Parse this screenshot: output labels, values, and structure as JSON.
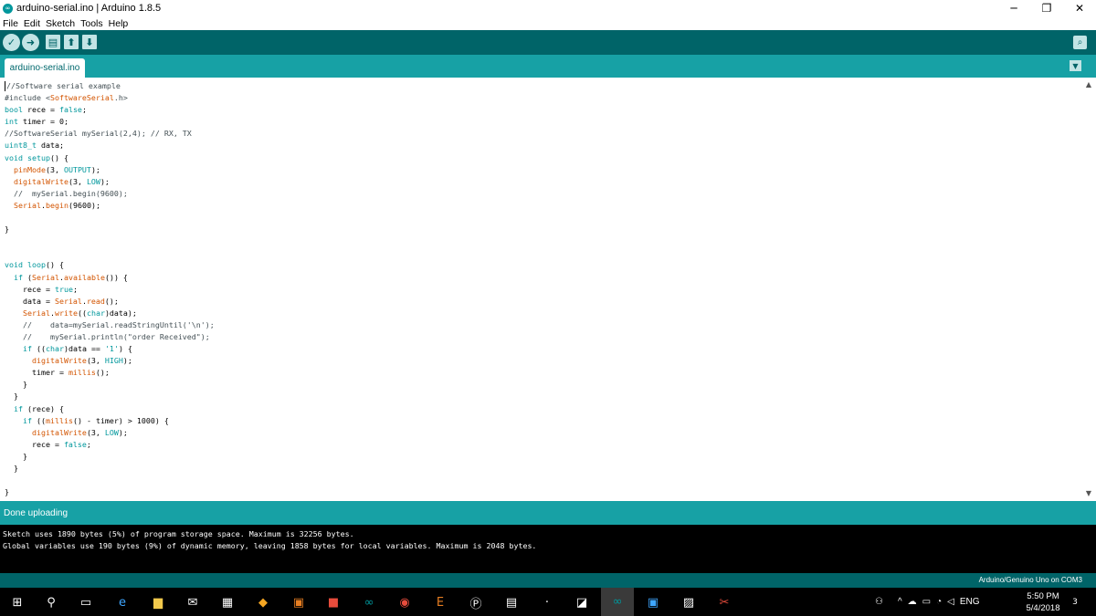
{
  "window": {
    "title": "arduino-serial.ino | Arduino 1.8.5",
    "logo_icon": "arduino-infinity-icon",
    "controls": [
      "─",
      "❐",
      "✕"
    ]
  },
  "menu": [
    "File",
    "Edit",
    "Sketch",
    "Tools",
    "Help"
  ],
  "toolbar": {
    "buttons": [
      "verify-icon",
      "upload-icon",
      "new-icon",
      "open-icon",
      "save-icon"
    ],
    "serial_monitor_icon": "magnifier-icon",
    "background": "#006468",
    "button_color": "#c2e4e5"
  },
  "tabs": {
    "active": "arduino-serial.ino",
    "menu_icon": "dropdown-triangle-icon"
  },
  "editor": {
    "lines": [
      [
        {
          "t": "//Software serial example",
          "c": "cm"
        }
      ],
      [
        {
          "t": "#include <",
          "c": "cm"
        },
        {
          "t": "SoftwareSerial",
          "c": "fn"
        },
        {
          "t": ".h>",
          "c": "cm"
        }
      ],
      [
        {
          "t": "bool",
          "c": "kw"
        },
        {
          "t": " rece = "
        },
        {
          "t": "false",
          "c": "kw"
        },
        {
          "t": ";"
        }
      ],
      [
        {
          "t": "int",
          "c": "kw"
        },
        {
          "t": " timer = 0;"
        }
      ],
      [
        {
          "t": "//SoftwareSerial mySerial(2,4); // RX, TX",
          "c": "cm"
        }
      ],
      [
        {
          "t": "uint8_t",
          "c": "kw"
        },
        {
          "t": " data;"
        }
      ],
      [
        {
          "t": "void",
          "c": "kw"
        },
        {
          "t": " "
        },
        {
          "t": "setup",
          "c": "kw"
        },
        {
          "t": "() {"
        }
      ],
      [
        {
          "t": "  "
        },
        {
          "t": "pinMode",
          "c": "fn"
        },
        {
          "t": "(3, "
        },
        {
          "t": "OUTPUT",
          "c": "kw"
        },
        {
          "t": ");"
        }
      ],
      [
        {
          "t": "  "
        },
        {
          "t": "digitalWrite",
          "c": "fn"
        },
        {
          "t": "(3, "
        },
        {
          "t": "LOW",
          "c": "kw"
        },
        {
          "t": ");"
        }
      ],
      [
        {
          "t": "  //  mySerial.begin(9600);",
          "c": "cm"
        }
      ],
      [
        {
          "t": "  "
        },
        {
          "t": "Serial",
          "c": "fn"
        },
        {
          "t": "."
        },
        {
          "t": "begin",
          "c": "fn"
        },
        {
          "t": "(9600);"
        }
      ],
      [
        {
          "t": ""
        }
      ],
      [
        {
          "t": "}"
        }
      ],
      [
        {
          "t": ""
        }
      ],
      [
        {
          "t": ""
        }
      ],
      [
        {
          "t": "void",
          "c": "kw"
        },
        {
          "t": " "
        },
        {
          "t": "loop",
          "c": "kw"
        },
        {
          "t": "() {"
        }
      ],
      [
        {
          "t": "  "
        },
        {
          "t": "if",
          "c": "kw"
        },
        {
          "t": " ("
        },
        {
          "t": "Serial",
          "c": "fn"
        },
        {
          "t": "."
        },
        {
          "t": "available",
          "c": "fn"
        },
        {
          "t": "()) {"
        }
      ],
      [
        {
          "t": "    rece = "
        },
        {
          "t": "true",
          "c": "kw"
        },
        {
          "t": ";"
        }
      ],
      [
        {
          "t": "    data = "
        },
        {
          "t": "Serial",
          "c": "fn"
        },
        {
          "t": "."
        },
        {
          "t": "read",
          "c": "fn"
        },
        {
          "t": "();"
        }
      ],
      [
        {
          "t": "    "
        },
        {
          "t": "Serial",
          "c": "fn"
        },
        {
          "t": "."
        },
        {
          "t": "write",
          "c": "fn"
        },
        {
          "t": "(("
        },
        {
          "t": "char",
          "c": "kw"
        },
        {
          "t": ")data);"
        }
      ],
      [
        {
          "t": "    //    data=mySerial.readStringUntil('\\n');",
          "c": "cm"
        }
      ],
      [
        {
          "t": "    //    mySerial.println(\"order Received\");",
          "c": "cm"
        }
      ],
      [
        {
          "t": "    "
        },
        {
          "t": "if",
          "c": "kw"
        },
        {
          "t": " (("
        },
        {
          "t": "char",
          "c": "kw"
        },
        {
          "t": ")data == "
        },
        {
          "t": "'1'",
          "c": "kw"
        },
        {
          "t": ") {"
        }
      ],
      [
        {
          "t": "      "
        },
        {
          "t": "digitalWrite",
          "c": "fn"
        },
        {
          "t": "(3, "
        },
        {
          "t": "HIGH",
          "c": "kw"
        },
        {
          "t": ");"
        }
      ],
      [
        {
          "t": "      timer = "
        },
        {
          "t": "millis",
          "c": "fn"
        },
        {
          "t": "();"
        }
      ],
      [
        {
          "t": "    }"
        }
      ],
      [
        {
          "t": "  }"
        }
      ],
      [
        {
          "t": "  "
        },
        {
          "t": "if",
          "c": "kw"
        },
        {
          "t": " (rece) {"
        }
      ],
      [
        {
          "t": "    "
        },
        {
          "t": "if",
          "c": "kw"
        },
        {
          "t": " (("
        },
        {
          "t": "millis",
          "c": "fn"
        },
        {
          "t": "() - timer) > 1000) {"
        }
      ],
      [
        {
          "t": "      "
        },
        {
          "t": "digitalWrite",
          "c": "fn"
        },
        {
          "t": "(3, "
        },
        {
          "t": "LOW",
          "c": "kw"
        },
        {
          "t": ");"
        }
      ],
      [
        {
          "t": "      rece = "
        },
        {
          "t": "false",
          "c": "kw"
        },
        {
          "t": ";"
        }
      ],
      [
        {
          "t": "    }"
        }
      ],
      [
        {
          "t": "  }"
        }
      ],
      [
        {
          "t": ""
        }
      ],
      [
        {
          "t": "}"
        }
      ]
    ],
    "colors": {
      "keyword": "#00979c",
      "function": "#d35400",
      "comment": "#434f54"
    }
  },
  "status": {
    "message": "Done uploading"
  },
  "console": {
    "lines": [
      "Sketch uses 1890 bytes (5%) of program storage space. Maximum is 32256 bytes.",
      "Global variables use 190 bytes (9%) of dynamic memory, leaving 1858 bytes for local variables. Maximum is 2048 bytes."
    ]
  },
  "board_info": "Arduino/Genuino Uno on COM3",
  "taskbar": {
    "apps": [
      "windows-start-icon",
      "search-icon",
      "task-view-icon",
      "edge-icon",
      "file-explorer-icon",
      "mail-icon",
      "store-icon",
      "app-icon",
      "paint-icon",
      "solidworks-icon",
      "arduino-icon",
      "chrome-icon",
      "e-app-icon",
      "p-app-icon",
      "notepad-icon",
      "dots-icon",
      "sticky-icon",
      "arduino-active-icon",
      "app-blue-icon",
      "photos-icon",
      "snipping-icon"
    ],
    "tray": {
      "language": "ENG",
      "time": "5:50 PM",
      "date": "5/4/2018",
      "notifications": "3"
    }
  }
}
